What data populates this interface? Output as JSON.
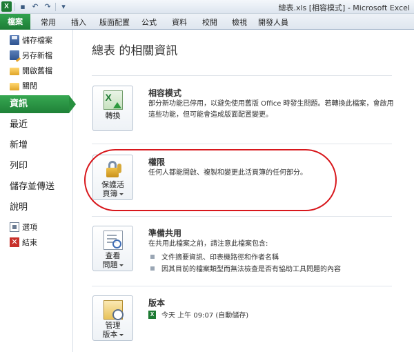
{
  "window": {
    "title": "總表.xls [相容模式] - Microsoft Excel"
  },
  "ribbon": {
    "tabs": [
      {
        "label": "檔案"
      },
      {
        "label": "常用"
      },
      {
        "label": "插入"
      },
      {
        "label": "版面配置"
      },
      {
        "label": "公式"
      },
      {
        "label": "資料"
      },
      {
        "label": "校閱"
      },
      {
        "label": "檢視"
      },
      {
        "label": "開發人員"
      }
    ]
  },
  "sidebar": {
    "commands": [
      {
        "label": "儲存檔案",
        "icon": "save-icon"
      },
      {
        "label": "另存新檔",
        "icon": "save-as-icon"
      },
      {
        "label": "開啟舊檔",
        "icon": "open-folder-icon"
      },
      {
        "label": "關閉",
        "icon": "close-folder-icon"
      }
    ],
    "tabs": [
      {
        "label": "資訊",
        "active": true
      },
      {
        "label": "最近"
      },
      {
        "label": "新增"
      },
      {
        "label": "列印"
      },
      {
        "label": "儲存並傳送"
      },
      {
        "label": "說明"
      }
    ],
    "bottom": [
      {
        "label": "選項",
        "icon": "options-icon"
      },
      {
        "label": "結束",
        "icon": "exit-icon"
      }
    ]
  },
  "main": {
    "title": "總表 的相關資訊",
    "sections": {
      "compat": {
        "button_label": "轉換",
        "title": "相容模式",
        "desc": "部分新功能已停用，以避免使用舊版 Office 時發生問題。若轉換此檔案，會啟用這些功能，但可能會造成版面配置變更。"
      },
      "permissions": {
        "button_line1": "保護活",
        "button_line2": "頁簿",
        "title": "權限",
        "desc": "任何人都能開啟、複製和變更此活頁簿的任何部分。"
      },
      "prepare": {
        "button_line1": "查看",
        "button_line2": "問題",
        "title": "準備共用",
        "desc": "在共用此檔案之前，請注意此檔案包含:",
        "bullets": [
          "文件摘要資訊、印表機路徑和作者名稱",
          "因其目前的檔案類型而無法檢查是否有協助工具問題的內容"
        ]
      },
      "versions": {
        "button_line1": "管理",
        "button_line2": "版本",
        "title": "版本",
        "entry": "今天 上午 09:07 (自動儲存)"
      }
    }
  },
  "colors": {
    "file_tab": "#1d7d36",
    "active_sidebar": "#27903f",
    "highlight_ring": "#d8171c"
  }
}
